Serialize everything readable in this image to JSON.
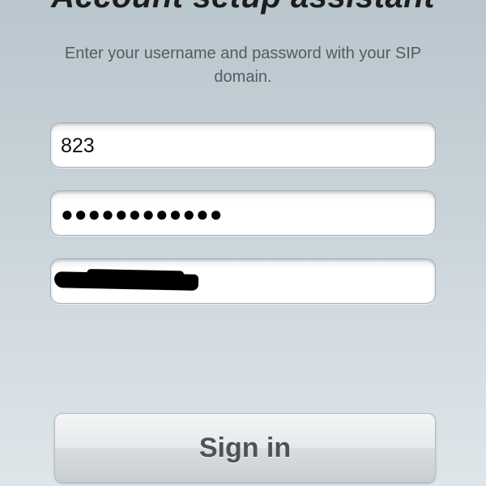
{
  "header": {
    "title": "Account setup assistant"
  },
  "instructions": "Enter your username and password with your SIP domain.",
  "form": {
    "username": {
      "value": "823"
    },
    "password": {
      "value": "●●●●●●●●●●●●"
    },
    "domain": {
      "value": ""
    }
  },
  "actions": {
    "sign_in_label": "Sign in"
  }
}
